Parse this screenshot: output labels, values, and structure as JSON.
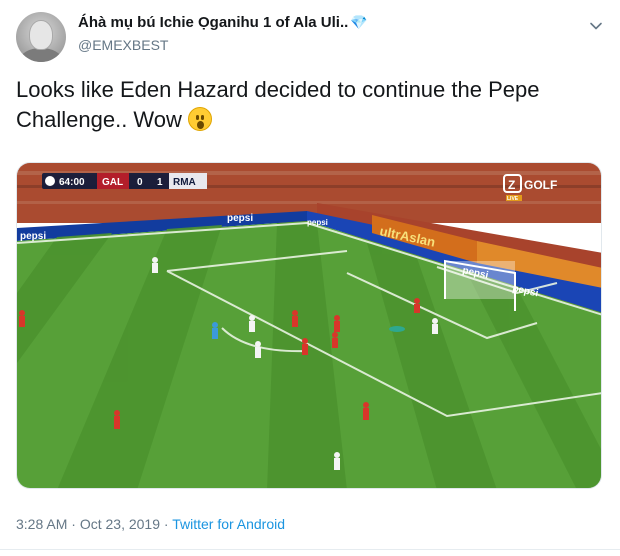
{
  "tweet": {
    "display_name": "Áhà mụ bú Ichie Ọganihu 1 of Ala Uli..",
    "name_emoji": "💎",
    "handle": "@EMEXBEST",
    "text": "Looks like Eden Hazard decided to continue the Pepe Challenge.. Wow",
    "text_emoji": "face-with-open-mouth-emoji",
    "time": "3:28 AM",
    "separator": "·",
    "date": "Oct 23, 2019",
    "source": "Twitter for Android"
  },
  "scoreboard": {
    "clock": "64:00",
    "home": "GAL",
    "home_score": "0",
    "away_score": "1",
    "away": "RMA"
  },
  "broadcast": {
    "channel": "GOLF",
    "channel_mark": "Z",
    "live": "LIVE"
  },
  "ads": {
    "pepsi": "pepsi",
    "banner": "ultrAslan"
  },
  "colors": {
    "link": "#1b95e0",
    "muted": "#657786",
    "pitch_light": "#5fa93c",
    "pitch_dark": "#4f9531"
  }
}
